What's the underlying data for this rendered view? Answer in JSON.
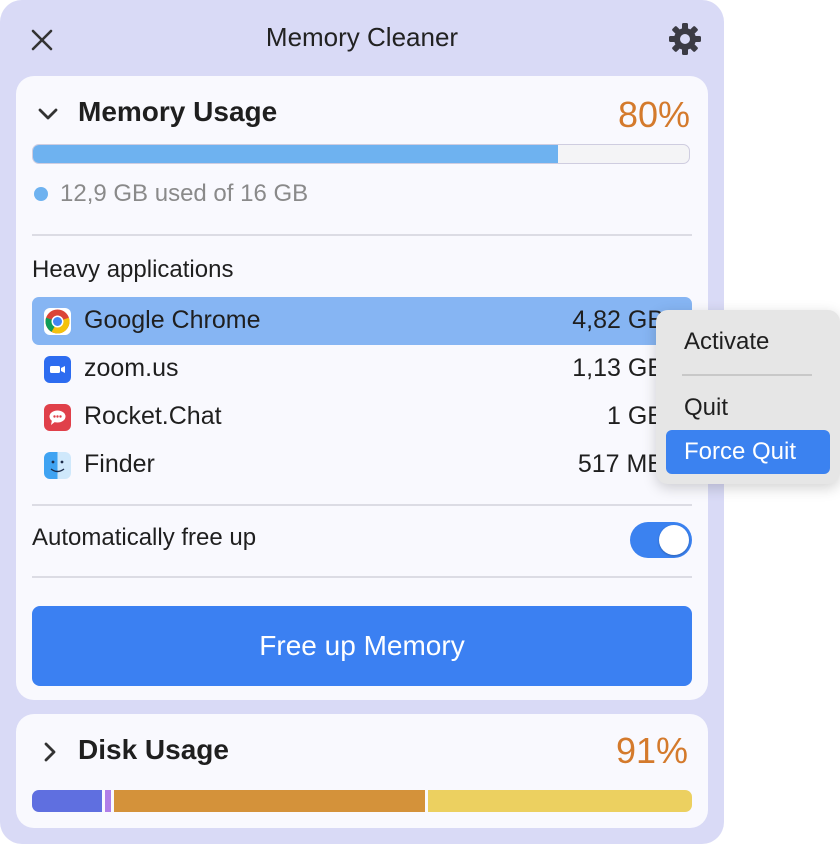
{
  "window": {
    "title": "Memory Cleaner",
    "close_icon": "close-icon",
    "settings_icon": "gear-icon"
  },
  "memory": {
    "title": "Memory Usage",
    "percent": "80%",
    "used_text": "12,9 GB used of 16 GB",
    "used_fraction": 0.8,
    "bar_color": "#6eb2f0",
    "expanded": true
  },
  "heavy_apps": {
    "title": "Heavy applications",
    "items": [
      {
        "name": "Google Chrome",
        "size": "4,82 GB",
        "icon": "chrome-icon",
        "selected": true
      },
      {
        "name": "zoom.us",
        "size": "1,13 GB",
        "icon": "zoom-icon",
        "selected": false
      },
      {
        "name": "Rocket.Chat",
        "size": "1 GB",
        "icon": "rocketchat-icon",
        "selected": false
      },
      {
        "name": "Finder",
        "size": "517 MB",
        "icon": "finder-icon",
        "selected": false
      }
    ]
  },
  "auto_free": {
    "label": "Automatically free up",
    "enabled": true
  },
  "free_button": {
    "label": "Free up Memory"
  },
  "disk": {
    "title": "Disk Usage",
    "percent": "91%",
    "expanded": false,
    "segments": [
      {
        "color": "#5f6fe0",
        "fraction": 0.11
      },
      {
        "color": "#b07ee8",
        "fraction": 0.015
      },
      {
        "color": "#d4923a",
        "fraction": 0.475
      },
      {
        "color": "#ecd060",
        "fraction": 0.4
      }
    ]
  },
  "context_menu": {
    "items": [
      "Activate",
      "Quit",
      "Force Quit"
    ],
    "highlighted": "Force Quit"
  },
  "colors": {
    "accent": "#3b80f2",
    "percent": "#d47a2c",
    "window_bg": "#d9daf6"
  }
}
